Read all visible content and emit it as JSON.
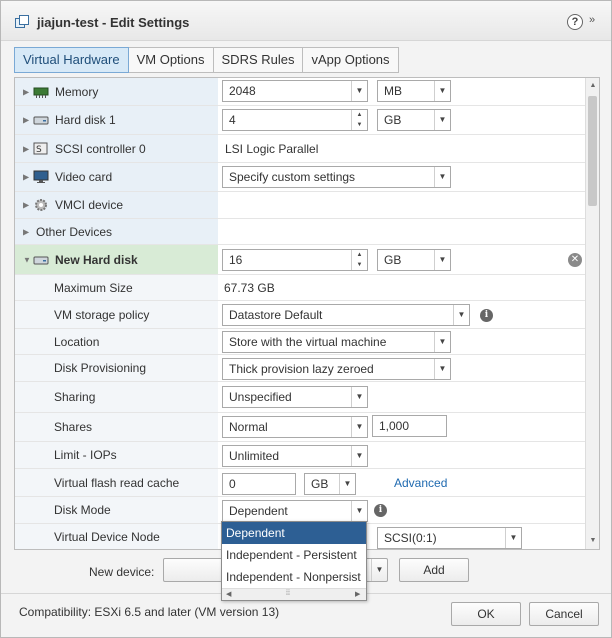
{
  "window": {
    "title": "jiajun-test - Edit Settings",
    "help_label": "?",
    "expand_label": "»"
  },
  "tabs": [
    {
      "label": "Virtual Hardware",
      "active": true
    },
    {
      "label": "VM Options",
      "active": false
    },
    {
      "label": "SDRS Rules",
      "active": false
    },
    {
      "label": "vApp Options",
      "active": false
    }
  ],
  "hardware": {
    "memory": {
      "label": "Memory",
      "value": "2048",
      "unit": "MB"
    },
    "hard_disk_1": {
      "label": "Hard disk 1",
      "value": "4",
      "unit": "GB"
    },
    "scsi_controller": {
      "label": "SCSI controller 0",
      "value": "LSI Logic Parallel"
    },
    "video_card": {
      "label": "Video card",
      "value": "Specify custom settings"
    },
    "vmci": {
      "label": "VMCI device"
    },
    "other_devices": {
      "label": "Other Devices"
    },
    "new_hard_disk": {
      "label": "New Hard disk",
      "value": "16",
      "unit": "GB",
      "max_size_label": "Maximum Size",
      "max_size_value": "67.73 GB",
      "storage_policy_label": "VM storage policy",
      "storage_policy_value": "Datastore Default",
      "location_label": "Location",
      "location_value": "Store with the virtual machine",
      "provisioning_label": "Disk Provisioning",
      "provisioning_value": "Thick provision lazy zeroed",
      "sharing_label": "Sharing",
      "sharing_value": "Unspecified",
      "shares_label": "Shares",
      "shares_value": "Normal",
      "shares_amount": "1,000",
      "limit_label": "Limit - IOPs",
      "limit_value": "Unlimited",
      "flash_label": "Virtual flash read cache",
      "flash_value": "0",
      "flash_unit": "GB",
      "flash_advanced": "Advanced",
      "disk_mode_label": "Disk Mode",
      "disk_mode_value": "Dependent",
      "device_node_label": "Virtual Device Node",
      "device_node_value": "SCSI(0:1)"
    }
  },
  "disk_mode_options": [
    "Dependent",
    "Independent - Persistent",
    "Independent - Nonpersist"
  ],
  "new_device": {
    "label": "New device:",
    "add_label": "Add"
  },
  "footer": {
    "compatibility": "Compatibility: ESXi 6.5 and later (VM version 13)",
    "ok_label": "OK",
    "cancel_label": "Cancel"
  },
  "icons": {
    "memory": "memory-chip-icon",
    "disk": "hard-disk-icon",
    "scsi": "scsi-controller-icon",
    "video": "monitor-icon",
    "vmci": "gear-icon"
  }
}
